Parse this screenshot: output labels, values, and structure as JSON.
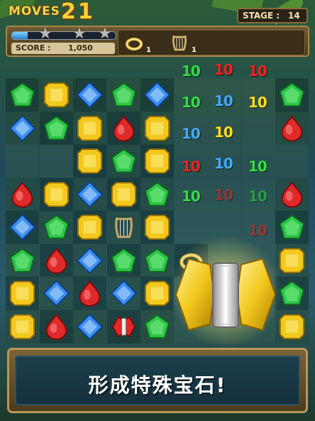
{
  "hud": {
    "moves_label": "MOVES",
    "moves_value": "21",
    "stage_label": "STAGE :",
    "stage_value": "14",
    "score_label": "SCORE :",
    "score_value": "1,050",
    "progress_fraction": 0.15,
    "stars": [
      "star-empty",
      "star-empty",
      "star-empty"
    ],
    "boosters": [
      {
        "name": "ring",
        "icon": "ring-icon",
        "count": "1"
      },
      {
        "name": "harp",
        "icon": "harp-icon",
        "count": "1"
      }
    ]
  },
  "floating_points": [
    {
      "text": "10",
      "color": "#33dd44"
    },
    {
      "text": "10",
      "color": "#ee2222"
    },
    {
      "text": "10",
      "color": "#ee2222"
    },
    {
      "text": "10",
      "color": "#33dd44"
    },
    {
      "text": "10",
      "color": "#44aaff"
    },
    {
      "text": "10",
      "color": "#ffdd22"
    },
    {
      "text": "10",
      "color": "#44aaff"
    },
    {
      "text": "10",
      "color": "#ffdd22"
    },
    {
      "text": "10",
      "color": "#ee2222"
    },
    {
      "text": "10",
      "color": "#44aaff"
    },
    {
      "text": "10",
      "color": "#33dd44"
    },
    {
      "text": "10",
      "color": "#33dd44"
    },
    {
      "text": "10",
      "color": "#ee2222"
    },
    {
      "text": "10",
      "color": "#33dd44"
    },
    {
      "text": "10",
      "color": "#ee2222"
    }
  ],
  "board": {
    "rows": [
      [
        "green",
        "yellow",
        "blue",
        "green",
        "blue",
        "",
        "",
        "",
        "green"
      ],
      [
        "blue",
        "green",
        "yellow",
        "red",
        "yellow",
        "",
        "",
        "",
        "red"
      ],
      [
        "",
        "",
        "yellow",
        "green",
        "yellow",
        "",
        "",
        "",
        ""
      ],
      [
        "red",
        "yellow",
        "blue",
        "yellow",
        "green",
        "",
        "",
        "",
        "red"
      ],
      [
        "blue",
        "green",
        "yellow",
        "harp",
        "yellow",
        "",
        "",
        "",
        "green"
      ],
      [
        "green",
        "red",
        "blue",
        "green",
        "green",
        "ring",
        "",
        "",
        "yellow"
      ],
      [
        "yellow",
        "blue",
        "red",
        "blue",
        "yellow",
        "",
        "",
        "",
        "green"
      ],
      [
        "yellow",
        "red",
        "blue",
        "bow",
        "green",
        "",
        "",
        "",
        "yellow"
      ]
    ],
    "gem_colors": {
      "green": "#2fc44a",
      "yellow": "#f2c81e",
      "blue": "#3a8ef0",
      "red": "#e02a2a"
    }
  },
  "banner": {
    "text": "形成特殊宝石!"
  }
}
